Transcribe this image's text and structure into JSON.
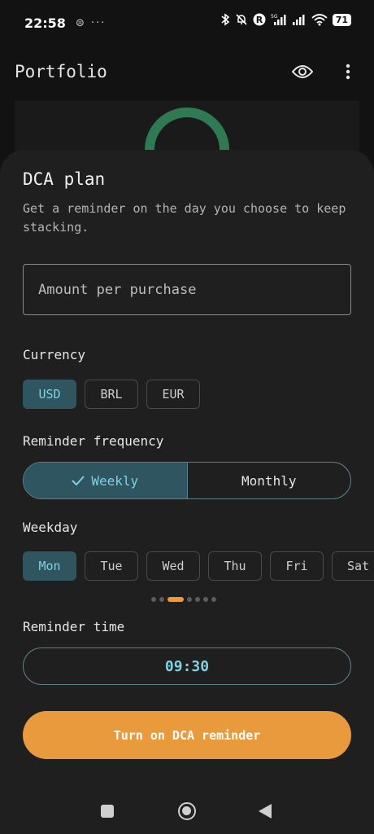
{
  "status_bar": {
    "time": "22:58",
    "left_icons": "⊜ ···",
    "battery": "71",
    "network": "5G"
  },
  "app_bar": {
    "title": "Portfolio"
  },
  "sheet": {
    "title": "DCA plan",
    "description": "Get a reminder on the day you choose to keep stacking.",
    "amount_placeholder": "Amount per purchase",
    "amount_value": "",
    "currency_label": "Currency",
    "currencies": [
      {
        "label": "USD",
        "selected": true
      },
      {
        "label": "BRL",
        "selected": false
      },
      {
        "label": "EUR",
        "selected": false
      }
    ],
    "frequency_label": "Reminder frequency",
    "frequency_options": [
      {
        "label": "Weekly",
        "selected": true
      },
      {
        "label": "Monthly",
        "selected": false
      }
    ],
    "weekday_label": "Weekday",
    "weekdays": [
      {
        "label": "Mon",
        "selected": true
      },
      {
        "label": "Tue",
        "selected": false
      },
      {
        "label": "Wed",
        "selected": false
      },
      {
        "label": "Thu",
        "selected": false
      },
      {
        "label": "Fri",
        "selected": false
      },
      {
        "label": "Sat",
        "selected": false
      }
    ],
    "page_indicator": {
      "count": 7,
      "active": 2
    },
    "time_label": "Reminder time",
    "time_value": "09:30",
    "cta_label": "Turn on DCA reminder"
  },
  "colors": {
    "accent_teal": "#7fd1e3",
    "selected_bg": "#2e5560",
    "cta_orange": "#e89a3c",
    "donut_green": "#2f7a52"
  }
}
